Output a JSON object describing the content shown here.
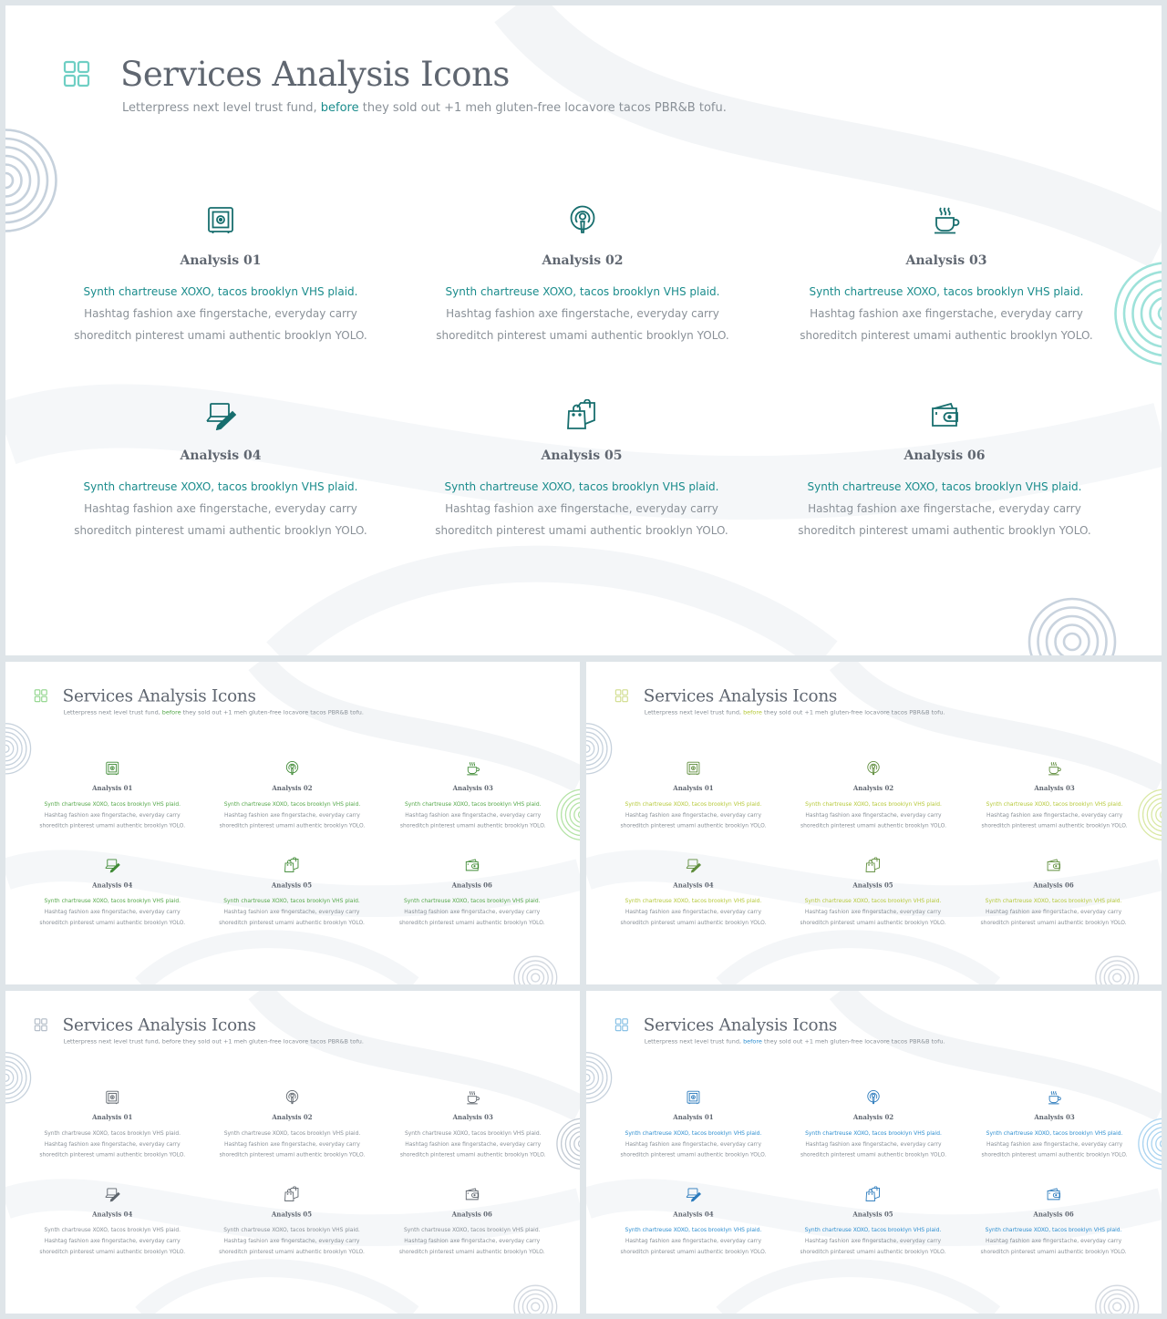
{
  "slide": {
    "title": "Services Analysis Icons",
    "subtitle_before": "Letterpress next level trust fund, ",
    "subtitle_highlight": "before",
    "subtitle_after": " they sold out +1 meh gluten-free locavore tacos PBR&B tofu.",
    "grid_icon": "grid-four-squares-icon",
    "cards": [
      {
        "icon": "safe-icon",
        "title": "Analysis 01",
        "line1": "Synth chartreuse XOXO, tacos brooklyn VHS plaid.",
        "line2": "Hashtag fashion axe fingerstache, everyday carry",
        "line3": "shoreditch pinterest umami authentic brooklyn YOLO."
      },
      {
        "icon": "podcast-icon",
        "title": "Analysis 02",
        "line1": "Synth chartreuse XOXO, tacos brooklyn VHS plaid.",
        "line2": "Hashtag fashion axe fingerstache, everyday carry",
        "line3": "shoreditch pinterest umami authentic brooklyn YOLO."
      },
      {
        "icon": "coffee-cup-icon",
        "title": "Analysis 03",
        "line1": "Synth chartreuse XOXO, tacos brooklyn VHS plaid.",
        "line2": "Hashtag fashion axe fingerstache, everyday carry",
        "line3": "shoreditch pinterest umami authentic brooklyn YOLO."
      },
      {
        "icon": "laptop-pen-icon",
        "title": "Analysis 04",
        "line1": "Synth chartreuse XOXO, tacos brooklyn VHS plaid.",
        "line2": "Hashtag fashion axe fingerstache, everyday carry",
        "line3": "shoreditch pinterest umami authentic brooklyn YOLO."
      },
      {
        "icon": "shopping-bags-icon",
        "title": "Analysis 05",
        "line1": "Synth chartreuse XOXO, tacos brooklyn VHS plaid.",
        "line2": "Hashtag fashion axe fingerstache, everyday carry",
        "line3": "shoreditch pinterest umami authentic brooklyn YOLO."
      },
      {
        "icon": "wallet-icon",
        "title": "Analysis 06",
        "line1": "Synth chartreuse XOXO, tacos brooklyn VHS plaid.",
        "line2": "Hashtag fashion axe fingerstache, everyday carry",
        "line3": "shoreditch pinterest umami authentic brooklyn YOLO."
      }
    ]
  },
  "variants": [
    {
      "theme": "teal",
      "primary": "#1a8c8c",
      "icon_color": "#176e6e",
      "grid": "#6fcfc4",
      "ring_side": "#9ee2da",
      "ring_gray": "#c9d3de"
    },
    {
      "theme": "green",
      "primary": "#55a84a",
      "icon_color": "#3f8a35",
      "grid": "#8dd488",
      "ring_side": "#b4e3a6",
      "ring_gray": "#cfd5dd"
    },
    {
      "theme": "lime",
      "primary": "#b6c93a",
      "icon_color": "#5f8d3c",
      "grid": "#cfdc8a",
      "ring_side": "#d9e8a4",
      "ring_gray": "#cfd5dd"
    },
    {
      "theme": "gray",
      "primary": "#8a9198",
      "icon_color": "#5d646c",
      "grid": "#aeb8c4",
      "ring_side": "#c2cad3",
      "ring_gray": "#cfd5dd"
    },
    {
      "theme": "blue",
      "primary": "#2f8fd0",
      "icon_color": "#2a7abc",
      "grid": "#7fbce3",
      "ring_side": "#a9d3f0",
      "ring_gray": "#cfd5dd"
    }
  ]
}
